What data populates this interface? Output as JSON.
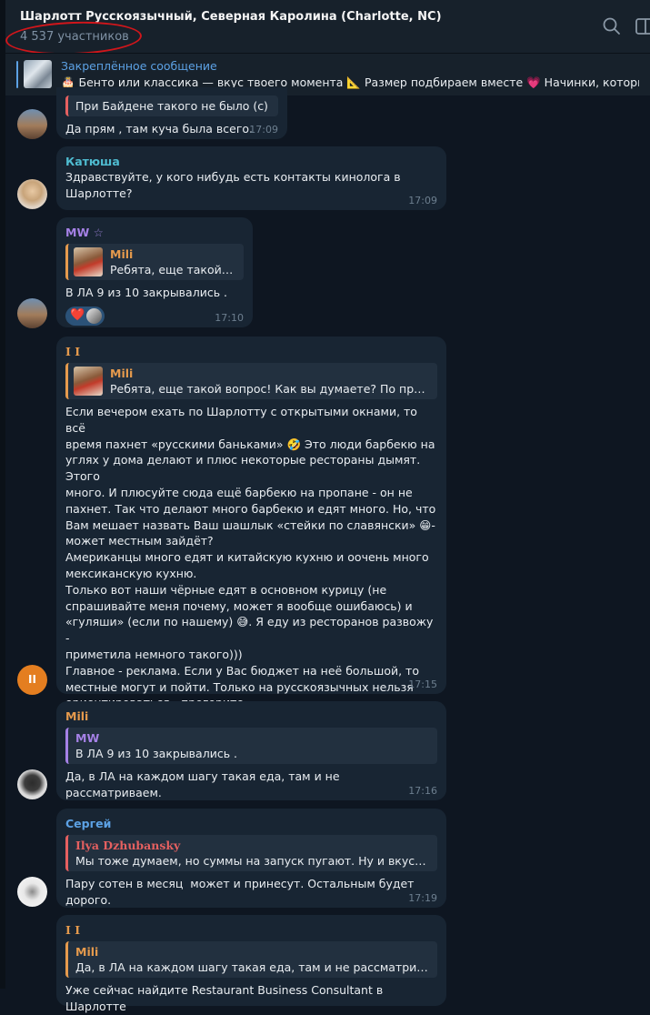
{
  "header": {
    "title": "Шарлотт Русскоязычный, Северная Каролина (Charlotte, NC)",
    "members": "4 537 участников",
    "search_icon": "search-icon",
    "sidebar_toggle_icon": "sidebar-toggle-icon"
  },
  "pinned": {
    "title": "Закреплённое сообщение",
    "text": "🎂 Бенто или классика — вкус твоего момента 📐 Размер подбираем вместе 💗 Начинки, которые ..."
  },
  "messages": [
    {
      "reply_text": "При Байдене такого не было (с)",
      "body": "Да прям , там куча была всего.",
      "time": "17:09"
    },
    {
      "sender": "Катюша",
      "body": "Здравствуйте, у кого нибудь есть контакты кинолога в\nШарлотте?",
      "time": "17:09"
    },
    {
      "sender": "MW",
      "sender_badge": "☆",
      "reply_name": "Mili",
      "reply_text": "Ребята, еще такой во...",
      "body": "В ЛА 9 из 10 закрывались .",
      "reaction": "❤️",
      "time": "17:10"
    },
    {
      "sender": "I I",
      "reply_name": "Mili",
      "reply_text": "Ребята, еще такой вопрос! Как вы думаете? По приезду....",
      "body": "Если вечером ехать по Шарлотту с открытыми окнами, то всё\nвремя пахнет «русскими баньками» 🤣 Это люди барбекю на\nуглях у дома делают и плюс некоторые рестораны дымят. Этого\nмного. И плюсуйте сюда ещё барбекю на пропане - он не\nпахнет. Так что делают много барбекю и едят много. Но, что\nВам мешает назвать Ваш шашлык «стейки по славянски» 😁-\nможет местным зайдёт?\nАмериканцы много едят и китайскую кухню и оочень много\nмексиканскую кухню.\nТолько вот наши чёрные едят в основном курицу (не\nспрашивайте меня почему, может я вообще ошибаюсь) и\n«гуляши» (если по нашему) 😅. Я еду из ресторанов развожу -\nприметила немного такого)))\nГлавное - реклама. Если у Вас бюджет на неё большой, то\nместные могут и пойти. Только на русскоязычных нельзя\nориентироваться - прогорите.",
      "reactions": [
        "❤️",
        "👍"
      ],
      "avatar_initials": "II",
      "time": "17:15"
    },
    {
      "sender": "Mili",
      "reply_name": "MW",
      "reply_text": "В ЛА 9 из 10 закрывались .",
      "body": "Да, в ЛА на каждом шагу такая еда, там и не рассматриваем.",
      "time": "17:16"
    },
    {
      "sender": "Сергей",
      "reply_name": "Ilya Dzhubansky",
      "reply_text": "Мы тоже думаем, но суммы на запуск пугают. Ну и вкусы де...",
      "body": "Пару сотен в месяц  может и принесут. Остальным будет дорого.",
      "time": "17:19"
    },
    {
      "sender": "I I",
      "reply_name": "Mili",
      "reply_text": "Да, в ЛА на каждом шагу такая еда, там и не рассматриваем.",
      "body": "Уже сейчас найдите Restaurant Business Consultant в Шарлотте"
    }
  ]
}
